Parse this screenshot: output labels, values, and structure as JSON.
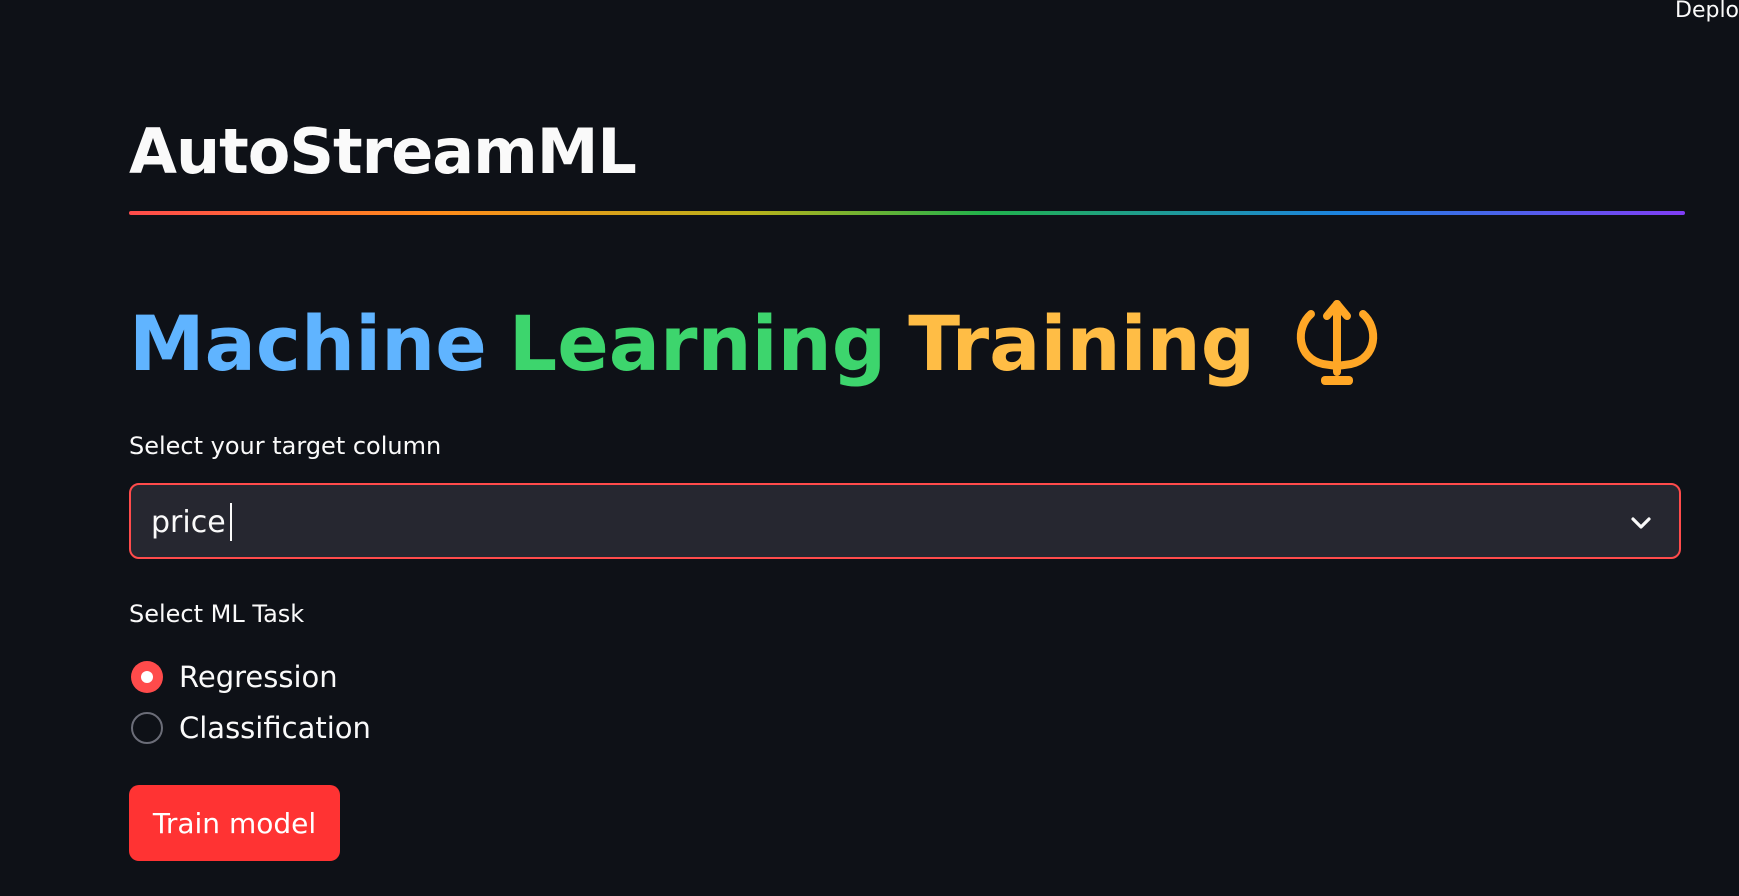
{
  "header": {
    "deploy_label": "Deplo"
  },
  "app": {
    "title": "AutoStreamML"
  },
  "section": {
    "heading_words": [
      "Machine",
      "Learning",
      "Training"
    ],
    "heading_icon": "trident-icon",
    "heading_colors": [
      "#60b4ff",
      "#3dd56d",
      "#ffbd45"
    ]
  },
  "target_select": {
    "label": "Select your target column",
    "value": "price"
  },
  "task": {
    "label": "Select ML Task",
    "options": [
      {
        "label": "Regression",
        "selected": true
      },
      {
        "label": "Classification",
        "selected": false
      }
    ]
  },
  "train_button": {
    "label": "Train model"
  },
  "colors": {
    "background": "#0e1117",
    "accent": "#ff4b4b",
    "button": "#ff3333",
    "input_bg": "#262730"
  }
}
